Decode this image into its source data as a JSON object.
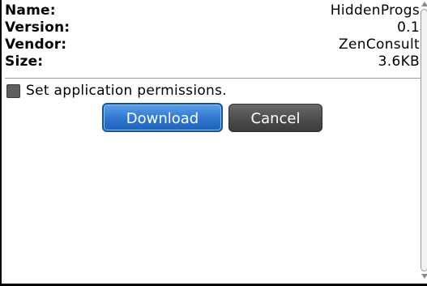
{
  "app_info": {
    "name": {
      "label": "Name:",
      "value": "HiddenProgs"
    },
    "version": {
      "label": "Version:",
      "value": "0.1"
    },
    "vendor": {
      "label": "Vendor:",
      "value": "ZenConsult"
    },
    "size": {
      "label": "Size:",
      "value": "3.6KB"
    }
  },
  "permissions": {
    "label": "Set application permissions.",
    "checked": false
  },
  "buttons": {
    "download_label": "Download",
    "cancel_label": "Cancel"
  },
  "colors": {
    "download_accent": "#2f76cf",
    "cancel_gray": "#4a4a4a"
  }
}
